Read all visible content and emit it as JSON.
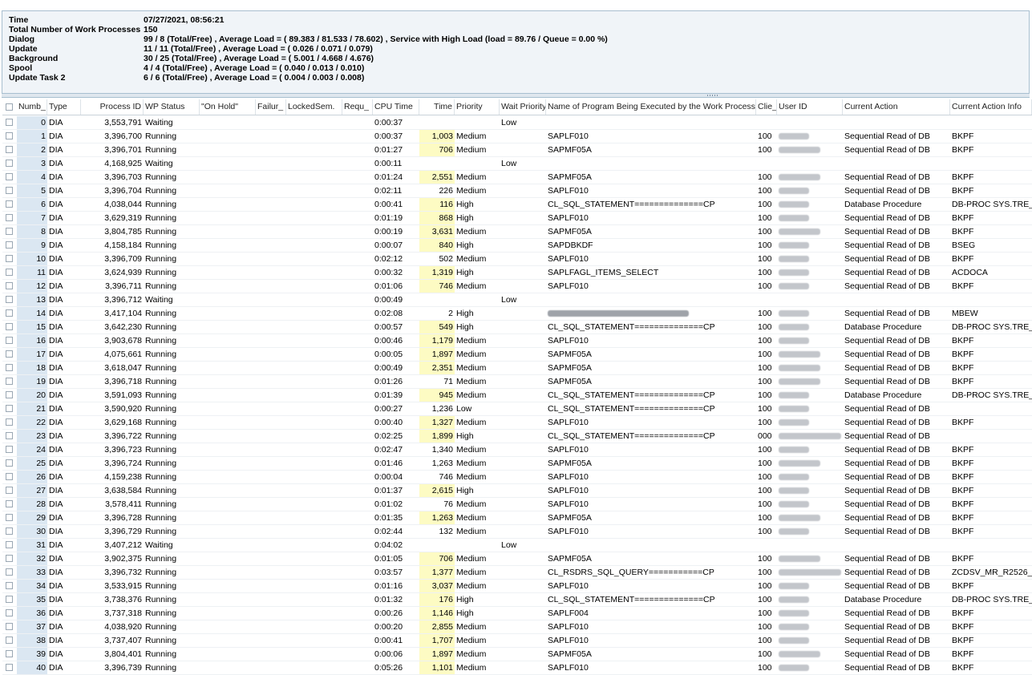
{
  "info": [
    {
      "label": "Time",
      "value": "07/27/2021, 08:56:21"
    },
    {
      "label": "Total Number of Work Processes",
      "value": "150"
    },
    {
      "label": "Dialog",
      "value": "99 / 8 (Total/Free) , Average Load = ( 89.383 / 81.533 / 78.602) , Service with High Load (load = 89.76 / Queue = 0.00 %)"
    },
    {
      "label": "Update",
      "value": "11 / 11 (Total/Free) , Average Load = ( 0.026 / 0.071 / 0.079)"
    },
    {
      "label": "Background",
      "value": "30 / 25 (Total/Free) , Average Load = ( 5.001 / 4.668 / 4.676)"
    },
    {
      "label": "Spool",
      "value": "4 / 4 (Total/Free) , Average Load = ( 0.040 / 0.013 / 0.010)"
    },
    {
      "label": "Update Task 2",
      "value": "6 / 6 (Total/Free) , Average Load = ( 0.004 / 0.003 / 0.008)"
    }
  ],
  "columns": [
    "Numb_",
    "Type",
    "Process ID",
    "WP Status",
    "\"On Hold\"",
    "Failur_",
    "LockedSem.",
    "Requ_",
    "CPU Time",
    "Time",
    "Priority",
    "Wait Priority",
    "Name of Program Being Executed by the Work Process",
    "Clie_",
    "User ID",
    "Current Action",
    "Current Action Info"
  ],
  "rows": [
    {
      "num": "0",
      "type": "DIA",
      "pid": "3,553,791",
      "status": "Waiting",
      "cpu": "0:00:37",
      "time": "",
      "prio": "",
      "wait": "Low",
      "prog": "",
      "client": "",
      "user": 0,
      "action": "",
      "info": ""
    },
    {
      "num": "1",
      "type": "DIA",
      "pid": "3,396,700",
      "status": "Running",
      "cpu": "0:00:37",
      "time": "1,003",
      "prio": "Medium",
      "wait": "",
      "prog": "SAPLF010",
      "client": "100",
      "user": 1,
      "action": "Sequential Read of DB",
      "info": "BKPF",
      "hl": true
    },
    {
      "num": "2",
      "type": "DIA",
      "pid": "3,396,701",
      "status": "Running",
      "cpu": "0:01:27",
      "time": "706",
      "prio": "Medium",
      "wait": "",
      "prog": "SAPMF05A",
      "client": "100",
      "user": 2,
      "action": "Sequential Read of DB",
      "info": "BKPF",
      "hl": true
    },
    {
      "num": "3",
      "type": "DIA",
      "pid": "4,168,925",
      "status": "Waiting",
      "cpu": "0:00:11",
      "time": "",
      "prio": "",
      "wait": "Low",
      "prog": "",
      "client": "",
      "user": 0,
      "action": "",
      "info": ""
    },
    {
      "num": "4",
      "type": "DIA",
      "pid": "3,396,703",
      "status": "Running",
      "cpu": "0:01:24",
      "time": "2,551",
      "prio": "Medium",
      "wait": "",
      "prog": "SAPMF05A",
      "client": "100",
      "user": 2,
      "action": "Sequential Read of DB",
      "info": "BKPF",
      "hl": true
    },
    {
      "num": "5",
      "type": "DIA",
      "pid": "3,396,704",
      "status": "Running",
      "cpu": "0:02:11",
      "time": "226",
      "prio": "Medium",
      "wait": "",
      "prog": "SAPLF010",
      "client": "100",
      "user": 1,
      "action": "Sequential Read of DB",
      "info": "BKPF"
    },
    {
      "num": "6",
      "type": "DIA",
      "pid": "4,038,044",
      "status": "Running",
      "cpu": "0:00:41",
      "time": "116",
      "prio": "High",
      "wait": "",
      "prog": "CL_SQL_STATEMENT==============CP",
      "client": "100",
      "user": 1,
      "action": "Database Procedure",
      "info": "DB-PROC SYS.TRE_",
      "hl": true
    },
    {
      "num": "7",
      "type": "DIA",
      "pid": "3,629,319",
      "status": "Running",
      "cpu": "0:01:19",
      "time": "868",
      "prio": "High",
      "wait": "",
      "prog": "SAPLF010",
      "client": "100",
      "user": 1,
      "action": "Sequential Read of DB",
      "info": "BKPF",
      "hl": true
    },
    {
      "num": "8",
      "type": "DIA",
      "pid": "3,804,785",
      "status": "Running",
      "cpu": "0:00:19",
      "time": "3,631",
      "prio": "Medium",
      "wait": "",
      "prog": "SAPMF05A",
      "client": "100",
      "user": 2,
      "action": "Sequential Read of DB",
      "info": "BKPF",
      "hl": true
    },
    {
      "num": "9",
      "type": "DIA",
      "pid": "4,158,184",
      "status": "Running",
      "cpu": "0:00:07",
      "time": "840",
      "prio": "High",
      "wait": "",
      "prog": "SAPDBKDF",
      "client": "100",
      "user": 1,
      "action": "Sequential Read of DB",
      "info": "BSEG",
      "hl": true
    },
    {
      "num": "10",
      "type": "DIA",
      "pid": "3,396,709",
      "status": "Running",
      "cpu": "0:02:12",
      "time": "502",
      "prio": "Medium",
      "wait": "",
      "prog": "SAPLF010",
      "client": "100",
      "user": 1,
      "action": "Sequential Read of DB",
      "info": "BKPF"
    },
    {
      "num": "11",
      "type": "DIA",
      "pid": "3,624,939",
      "status": "Running",
      "cpu": "0:00:32",
      "time": "1,319",
      "prio": "High",
      "wait": "",
      "prog": "SAPLFAGL_ITEMS_SELECT",
      "client": "100",
      "user": 1,
      "action": "Sequential Read of DB",
      "info": "ACDOCA",
      "hl": true
    },
    {
      "num": "12",
      "type": "DIA",
      "pid": "3,396,711",
      "status": "Running",
      "cpu": "0:01:06",
      "time": "746",
      "prio": "Medium",
      "wait": "",
      "prog": "SAPLF010",
      "client": "100",
      "user": 1,
      "action": "Sequential Read of DB",
      "info": "BKPF",
      "hl": true
    },
    {
      "num": "13",
      "type": "DIA",
      "pid": "3,396,712",
      "status": "Waiting",
      "cpu": "0:00:49",
      "time": "",
      "prio": "",
      "wait": "Low",
      "prog": "",
      "client": "",
      "user": 0,
      "action": "",
      "info": ""
    },
    {
      "num": "14",
      "type": "DIA",
      "pid": "3,417,104",
      "status": "Running",
      "cpu": "0:02:08",
      "time": "2",
      "prio": "High",
      "wait": "",
      "prog": "",
      "client": "100",
      "user": 1,
      "action": "Sequential Read of DB",
      "info": "MBEW",
      "progblur": true
    },
    {
      "num": "15",
      "type": "DIA",
      "pid": "3,642,230",
      "status": "Running",
      "cpu": "0:00:57",
      "time": "549",
      "prio": "High",
      "wait": "",
      "prog": "CL_SQL_STATEMENT==============CP",
      "client": "100",
      "user": 1,
      "action": "Database Procedure",
      "info": "DB-PROC SYS.TRE_",
      "hl": true
    },
    {
      "num": "16",
      "type": "DIA",
      "pid": "3,903,678",
      "status": "Running",
      "cpu": "0:00:46",
      "time": "1,179",
      "prio": "Medium",
      "wait": "",
      "prog": "SAPLF010",
      "client": "100",
      "user": 1,
      "action": "Sequential Read of DB",
      "info": "BKPF",
      "hl": true
    },
    {
      "num": "17",
      "type": "DIA",
      "pid": "4,075,661",
      "status": "Running",
      "cpu": "0:00:05",
      "time": "1,897",
      "prio": "Medium",
      "wait": "",
      "prog": "SAPMF05A",
      "client": "100",
      "user": 2,
      "action": "Sequential Read of DB",
      "info": "BKPF",
      "hl": true
    },
    {
      "num": "18",
      "type": "DIA",
      "pid": "3,618,047",
      "status": "Running",
      "cpu": "0:00:49",
      "time": "2,351",
      "prio": "Medium",
      "wait": "",
      "prog": "SAPMF05A",
      "client": "100",
      "user": 2,
      "action": "Sequential Read of DB",
      "info": "BKPF",
      "hl": true
    },
    {
      "num": "19",
      "type": "DIA",
      "pid": "3,396,718",
      "status": "Running",
      "cpu": "0:01:26",
      "time": "71",
      "prio": "Medium",
      "wait": "",
      "prog": "SAPMF05A",
      "client": "100",
      "user": 2,
      "action": "Sequential Read of DB",
      "info": "BKPF"
    },
    {
      "num": "20",
      "type": "DIA",
      "pid": "3,591,093",
      "status": "Running",
      "cpu": "0:01:39",
      "time": "945",
      "prio": "Medium",
      "wait": "",
      "prog": "CL_SQL_STATEMENT==============CP",
      "client": "100",
      "user": 1,
      "action": "Database Procedure",
      "info": "DB-PROC SYS.TRE_",
      "hl": true
    },
    {
      "num": "21",
      "type": "DIA",
      "pid": "3,590,920",
      "status": "Running",
      "cpu": "0:00:27",
      "time": "1,236",
      "prio": "Low",
      "wait": "",
      "prog": "CL_SQL_STATEMENT==============CP",
      "client": "100",
      "user": 1,
      "action": "Sequential Read of DB",
      "info": ""
    },
    {
      "num": "22",
      "type": "DIA",
      "pid": "3,629,168",
      "status": "Running",
      "cpu": "0:00:40",
      "time": "1,327",
      "prio": "Medium",
      "wait": "",
      "prog": "SAPLF010",
      "client": "100",
      "user": 1,
      "action": "Sequential Read of DB",
      "info": "BKPF",
      "hl": true
    },
    {
      "num": "23",
      "type": "DIA",
      "pid": "3,396,722",
      "status": "Running",
      "cpu": "0:02:25",
      "time": "1,899",
      "prio": "High",
      "wait": "",
      "prog": "CL_SQL_STATEMENT==============CP",
      "client": "000",
      "user": 3,
      "action": "Sequential Read of DB",
      "info": "",
      "hl": true
    },
    {
      "num": "24",
      "type": "DIA",
      "pid": "3,396,723",
      "status": "Running",
      "cpu": "0:02:47",
      "time": "1,340",
      "prio": "Medium",
      "wait": "",
      "prog": "SAPLF010",
      "client": "100",
      "user": 1,
      "action": "Sequential Read of DB",
      "info": "BKPF"
    },
    {
      "num": "25",
      "type": "DIA",
      "pid": "3,396,724",
      "status": "Running",
      "cpu": "0:01:46",
      "time": "1,263",
      "prio": "Medium",
      "wait": "",
      "prog": "SAPMF05A",
      "client": "100",
      "user": 2,
      "action": "Sequential Read of DB",
      "info": "BKPF"
    },
    {
      "num": "26",
      "type": "DIA",
      "pid": "4,159,238",
      "status": "Running",
      "cpu": "0:00:04",
      "time": "746",
      "prio": "Medium",
      "wait": "",
      "prog": "SAPLF010",
      "client": "100",
      "user": 1,
      "action": "Sequential Read of DB",
      "info": "BKPF"
    },
    {
      "num": "27",
      "type": "DIA",
      "pid": "3,638,584",
      "status": "Running",
      "cpu": "0:01:37",
      "time": "2,615",
      "prio": "High",
      "wait": "",
      "prog": "SAPLF010",
      "client": "100",
      "user": 1,
      "action": "Sequential Read of DB",
      "info": "BKPF",
      "hl": true
    },
    {
      "num": "28",
      "type": "DIA",
      "pid": "3,578,411",
      "status": "Running",
      "cpu": "0:01:02",
      "time": "76",
      "prio": "Medium",
      "wait": "",
      "prog": "SAPLF010",
      "client": "100",
      "user": 1,
      "action": "Sequential Read of DB",
      "info": "BKPF"
    },
    {
      "num": "29",
      "type": "DIA",
      "pid": "3,396,728",
      "status": "Running",
      "cpu": "0:01:35",
      "time": "1,263",
      "prio": "Medium",
      "wait": "",
      "prog": "SAPMF05A",
      "client": "100",
      "user": 2,
      "action": "Sequential Read of DB",
      "info": "BKPF",
      "hl": true
    },
    {
      "num": "30",
      "type": "DIA",
      "pid": "3,396,729",
      "status": "Running",
      "cpu": "0:02:44",
      "time": "132",
      "prio": "Medium",
      "wait": "",
      "prog": "SAPLF010",
      "client": "100",
      "user": 1,
      "action": "Sequential Read of DB",
      "info": "BKPF"
    },
    {
      "num": "31",
      "type": "DIA",
      "pid": "3,407,212",
      "status": "Waiting",
      "cpu": "0:04:02",
      "time": "",
      "prio": "",
      "wait": "Low",
      "prog": "",
      "client": "",
      "user": 0,
      "action": "",
      "info": ""
    },
    {
      "num": "32",
      "type": "DIA",
      "pid": "3,902,375",
      "status": "Running",
      "cpu": "0:01:05",
      "time": "706",
      "prio": "Medium",
      "wait": "",
      "prog": "SAPMF05A",
      "client": "100",
      "user": 2,
      "action": "Sequential Read of DB",
      "info": "BKPF",
      "hl": true
    },
    {
      "num": "33",
      "type": "DIA",
      "pid": "3,396,732",
      "status": "Running",
      "cpu": "0:03:57",
      "time": "1,377",
      "prio": "Medium",
      "wait": "",
      "prog": "CL_RSDRS_SQL_QUERY===========CP",
      "client": "100",
      "user": 3,
      "action": "Sequential Read of DB",
      "info": "ZCDSV_MR_R2526_",
      "hl": true
    },
    {
      "num": "34",
      "type": "DIA",
      "pid": "3,533,915",
      "status": "Running",
      "cpu": "0:01:16",
      "time": "3,037",
      "prio": "Medium",
      "wait": "",
      "prog": "SAPLF010",
      "client": "100",
      "user": 1,
      "action": "Sequential Read of DB",
      "info": "BKPF",
      "hl": true
    },
    {
      "num": "35",
      "type": "DIA",
      "pid": "3,738,376",
      "status": "Running",
      "cpu": "0:01:32",
      "time": "176",
      "prio": "High",
      "wait": "",
      "prog": "CL_SQL_STATEMENT==============CP",
      "client": "100",
      "user": 1,
      "action": "Database Procedure",
      "info": "DB-PROC SYS.TRE_",
      "hl": true
    },
    {
      "num": "36",
      "type": "DIA",
      "pid": "3,737,318",
      "status": "Running",
      "cpu": "0:00:26",
      "time": "1,146",
      "prio": "High",
      "wait": "",
      "prog": "SAPLF004",
      "client": "100",
      "user": 1,
      "action": "Sequential Read of DB",
      "info": "BKPF",
      "hl": true
    },
    {
      "num": "37",
      "type": "DIA",
      "pid": "4,038,920",
      "status": "Running",
      "cpu": "0:00:20",
      "time": "2,855",
      "prio": "Medium",
      "wait": "",
      "prog": "SAPLF010",
      "client": "100",
      "user": 1,
      "action": "Sequential Read of DB",
      "info": "BKPF",
      "hl": true
    },
    {
      "num": "38",
      "type": "DIA",
      "pid": "3,737,407",
      "status": "Running",
      "cpu": "0:00:41",
      "time": "1,707",
      "prio": "Medium",
      "wait": "",
      "prog": "SAPLF010",
      "client": "100",
      "user": 1,
      "action": "Sequential Read of DB",
      "info": "BKPF",
      "hl": true
    },
    {
      "num": "39",
      "type": "DIA",
      "pid": "3,804,401",
      "status": "Running",
      "cpu": "0:00:06",
      "time": "1,897",
      "prio": "Medium",
      "wait": "",
      "prog": "SAPMF05A",
      "client": "100",
      "user": 2,
      "action": "Sequential Read of DB",
      "info": "BKPF",
      "hl": true
    },
    {
      "num": "40",
      "type": "DIA",
      "pid": "3,396,739",
      "status": "Running",
      "cpu": "0:05:26",
      "time": "1,101",
      "prio": "Medium",
      "wait": "",
      "prog": "SAPLF010",
      "client": "100",
      "user": 1,
      "action": "Sequential Read of DB",
      "info": "BKPF",
      "hl": true
    }
  ],
  "colors": {
    "time_highlight": "#fdfbc3",
    "number_column": "#dbe7f2",
    "panel_background": "#f0f4f8"
  }
}
